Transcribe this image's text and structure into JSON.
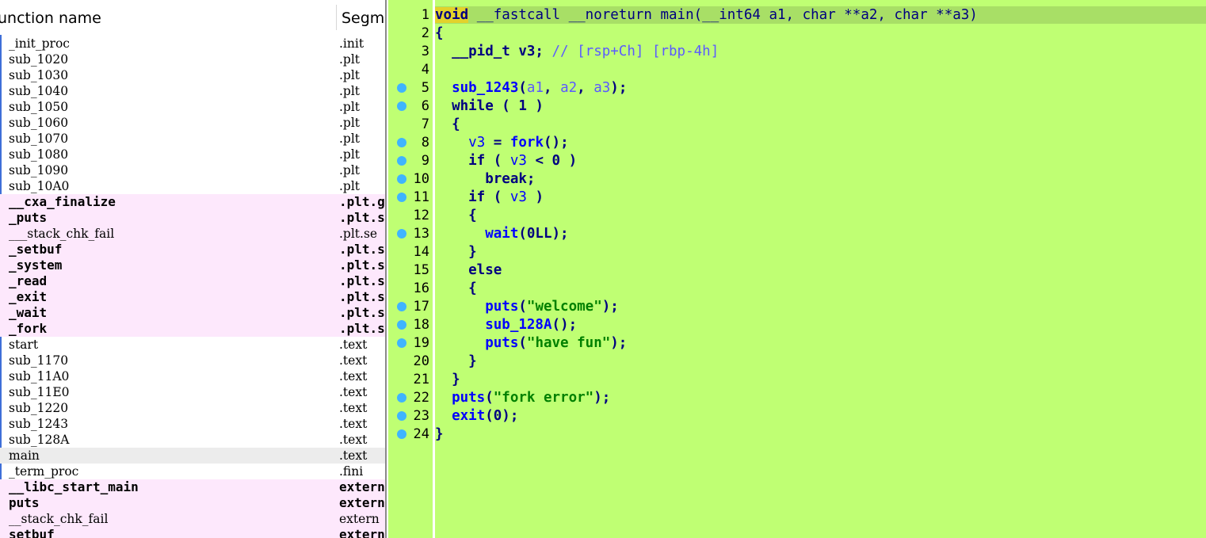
{
  "functions_panel": {
    "header": {
      "name_col": "unction name",
      "segment_col": "Segme"
    },
    "rows": [
      {
        "name": "_init_proc",
        "segment": ".init",
        "style": "plain"
      },
      {
        "name": "sub_1020",
        "segment": ".plt",
        "style": "plain"
      },
      {
        "name": "sub_1030",
        "segment": ".plt",
        "style": "plain"
      },
      {
        "name": "sub_1040",
        "segment": ".plt",
        "style": "plain"
      },
      {
        "name": "sub_1050",
        "segment": ".plt",
        "style": "plain"
      },
      {
        "name": "sub_1060",
        "segment": ".plt",
        "style": "plain"
      },
      {
        "name": "sub_1070",
        "segment": ".plt",
        "style": "plain"
      },
      {
        "name": "sub_1080",
        "segment": ".plt",
        "style": "plain"
      },
      {
        "name": "sub_1090",
        "segment": ".plt",
        "style": "plain"
      },
      {
        "name": "sub_10A0",
        "segment": ".plt",
        "style": "plain"
      },
      {
        "name": "__cxa_finalize",
        "segment": ".plt.g",
        "style": "lib-bold"
      },
      {
        "name": "_puts",
        "segment": ".plt.s",
        "style": "lib-bold"
      },
      {
        "name": "___stack_chk_fail",
        "segment": ".plt.se",
        "style": "lib"
      },
      {
        "name": "_setbuf",
        "segment": ".plt.s",
        "style": "lib-bold"
      },
      {
        "name": "_system",
        "segment": ".plt.s",
        "style": "lib-bold"
      },
      {
        "name": "_read",
        "segment": ".plt.s",
        "style": "lib-bold"
      },
      {
        "name": "_exit",
        "segment": ".plt.s",
        "style": "lib-bold"
      },
      {
        "name": "_wait",
        "segment": ".plt.s",
        "style": "lib-bold"
      },
      {
        "name": "_fork",
        "segment": ".plt.s",
        "style": "lib-bold"
      },
      {
        "name": "start",
        "segment": ".text",
        "style": "plain"
      },
      {
        "name": "sub_1170",
        "segment": ".text",
        "style": "plain"
      },
      {
        "name": "sub_11A0",
        "segment": ".text",
        "style": "plain"
      },
      {
        "name": "sub_11E0",
        "segment": ".text",
        "style": "plain"
      },
      {
        "name": "sub_1220",
        "segment": ".text",
        "style": "plain"
      },
      {
        "name": "sub_1243",
        "segment": ".text",
        "style": "plain"
      },
      {
        "name": "sub_128A",
        "segment": ".text",
        "style": "plain"
      },
      {
        "name": "main",
        "segment": ".text",
        "style": "selected"
      },
      {
        "name": "_term_proc",
        "segment": ".fini",
        "style": "plain"
      },
      {
        "name": "__libc_start_main",
        "segment": "extern",
        "style": "lib-bold"
      },
      {
        "name": "puts",
        "segment": "extern",
        "style": "lib-bold"
      },
      {
        "name": "__stack_chk_fail",
        "segment": "extern",
        "style": "lib"
      },
      {
        "name": "setbuf",
        "segment": "extern",
        "style": "lib-bold"
      }
    ]
  },
  "pseudocode": {
    "colors": {
      "background": "#bfff73",
      "breakpoint": "#3fb4ff",
      "keyword": "#000080",
      "function": "#0000ff",
      "string": "#008000"
    },
    "lines": [
      {
        "num": "1",
        "bp": false,
        "tokens": [
          [
            "void",
            "void"
          ],
          [
            " __fastcall __noreturn main(__int64 a1, char **a2, char **a3)",
            "sig"
          ]
        ]
      },
      {
        "num": "2",
        "bp": false,
        "tokens": [
          [
            "{",
            "p"
          ]
        ]
      },
      {
        "num": "3",
        "bp": false,
        "tokens": [
          [
            "  __pid_t v3; ",
            "kw"
          ],
          [
            "// [rsp+Ch] [rbp-4h]",
            "cm"
          ]
        ]
      },
      {
        "num": "4",
        "bp": false,
        "tokens": []
      },
      {
        "num": "5",
        "bp": true,
        "tokens": [
          [
            "  sub_1243",
            "fn"
          ],
          [
            "(",
            "p"
          ],
          [
            "a1",
            "arg"
          ],
          [
            ", ",
            "p"
          ],
          [
            "a2",
            "arg"
          ],
          [
            ", ",
            "p"
          ],
          [
            "a3",
            "arg"
          ],
          [
            ");",
            "p"
          ]
        ]
      },
      {
        "num": "6",
        "bp": true,
        "tokens": [
          [
            "  while ( 1 )",
            "kw"
          ]
        ]
      },
      {
        "num": "7",
        "bp": false,
        "tokens": [
          [
            "  {",
            "p"
          ]
        ]
      },
      {
        "num": "8",
        "bp": true,
        "tokens": [
          [
            "    ",
            "p"
          ],
          [
            "v3",
            "var"
          ],
          [
            " = ",
            "p"
          ],
          [
            "fork",
            "fn"
          ],
          [
            "();",
            "p"
          ]
        ]
      },
      {
        "num": "9",
        "bp": true,
        "tokens": [
          [
            "    if ( ",
            "kw"
          ],
          [
            "v3",
            "var"
          ],
          [
            " < 0 )",
            "kw"
          ]
        ]
      },
      {
        "num": "10",
        "bp": true,
        "tokens": [
          [
            "      break;",
            "kw"
          ]
        ]
      },
      {
        "num": "11",
        "bp": true,
        "tokens": [
          [
            "    if ( ",
            "kw"
          ],
          [
            "v3",
            "var"
          ],
          [
            " )",
            "kw"
          ]
        ]
      },
      {
        "num": "12",
        "bp": false,
        "tokens": [
          [
            "    {",
            "p"
          ]
        ]
      },
      {
        "num": "13",
        "bp": true,
        "tokens": [
          [
            "      wait",
            "fn"
          ],
          [
            "(0LL);",
            "p"
          ]
        ]
      },
      {
        "num": "14",
        "bp": false,
        "tokens": [
          [
            "    }",
            "p"
          ]
        ]
      },
      {
        "num": "15",
        "bp": false,
        "tokens": [
          [
            "    else",
            "kw"
          ]
        ]
      },
      {
        "num": "16",
        "bp": false,
        "tokens": [
          [
            "    {",
            "p"
          ]
        ]
      },
      {
        "num": "17",
        "bp": true,
        "tokens": [
          [
            "      puts",
            "fn"
          ],
          [
            "(",
            "p"
          ],
          [
            "\"welcome\"",
            "str"
          ],
          [
            ");",
            "p"
          ]
        ]
      },
      {
        "num": "18",
        "bp": true,
        "tokens": [
          [
            "      sub_128A",
            "fn"
          ],
          [
            "();",
            "p"
          ]
        ]
      },
      {
        "num": "19",
        "bp": true,
        "tokens": [
          [
            "      puts",
            "fn"
          ],
          [
            "(",
            "p"
          ],
          [
            "\"have fun\"",
            "str"
          ],
          [
            ");",
            "p"
          ]
        ]
      },
      {
        "num": "20",
        "bp": false,
        "tokens": [
          [
            "    }",
            "p"
          ]
        ]
      },
      {
        "num": "21",
        "bp": false,
        "tokens": [
          [
            "  }",
            "p"
          ]
        ]
      },
      {
        "num": "22",
        "bp": true,
        "tokens": [
          [
            "  puts",
            "fn"
          ],
          [
            "(",
            "p"
          ],
          [
            "\"fork error\"",
            "str"
          ],
          [
            ");",
            "p"
          ]
        ]
      },
      {
        "num": "23",
        "bp": true,
        "tokens": [
          [
            "  exit",
            "fn"
          ],
          [
            "(0);",
            "p"
          ]
        ]
      },
      {
        "num": "24",
        "bp": true,
        "tokens": [
          [
            "}",
            "p"
          ]
        ]
      }
    ]
  }
}
